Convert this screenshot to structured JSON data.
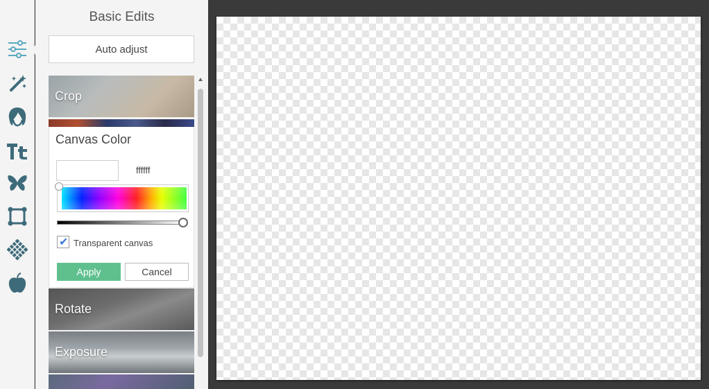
{
  "panel": {
    "title": "Basic Edits",
    "auto_adjust_label": "Auto adjust"
  },
  "rail": {
    "tools": [
      {
        "icon": "sliders-icon",
        "active": true
      },
      {
        "icon": "magic-wand-icon"
      },
      {
        "icon": "face-icon"
      },
      {
        "icon": "text-icon"
      },
      {
        "icon": "butterfly-icon"
      },
      {
        "icon": "frame-icon"
      },
      {
        "icon": "texture-icon"
      },
      {
        "icon": "apple-icon"
      }
    ]
  },
  "sections": {
    "crop": "Crop",
    "rotate": "Rotate",
    "exposure": "Exposure"
  },
  "canvas_color": {
    "title": "Canvas Color",
    "hex": "ffffff",
    "brightness": 1.0,
    "transparent_label": "Transparent canvas",
    "transparent_checked": true,
    "apply_label": "Apply",
    "cancel_label": "Cancel"
  },
  "colors": {
    "accent": "#5fc08e",
    "icon": "#3e6b7a",
    "icon_active": "#5aa8c0",
    "workspace": "#3a3a3a"
  }
}
